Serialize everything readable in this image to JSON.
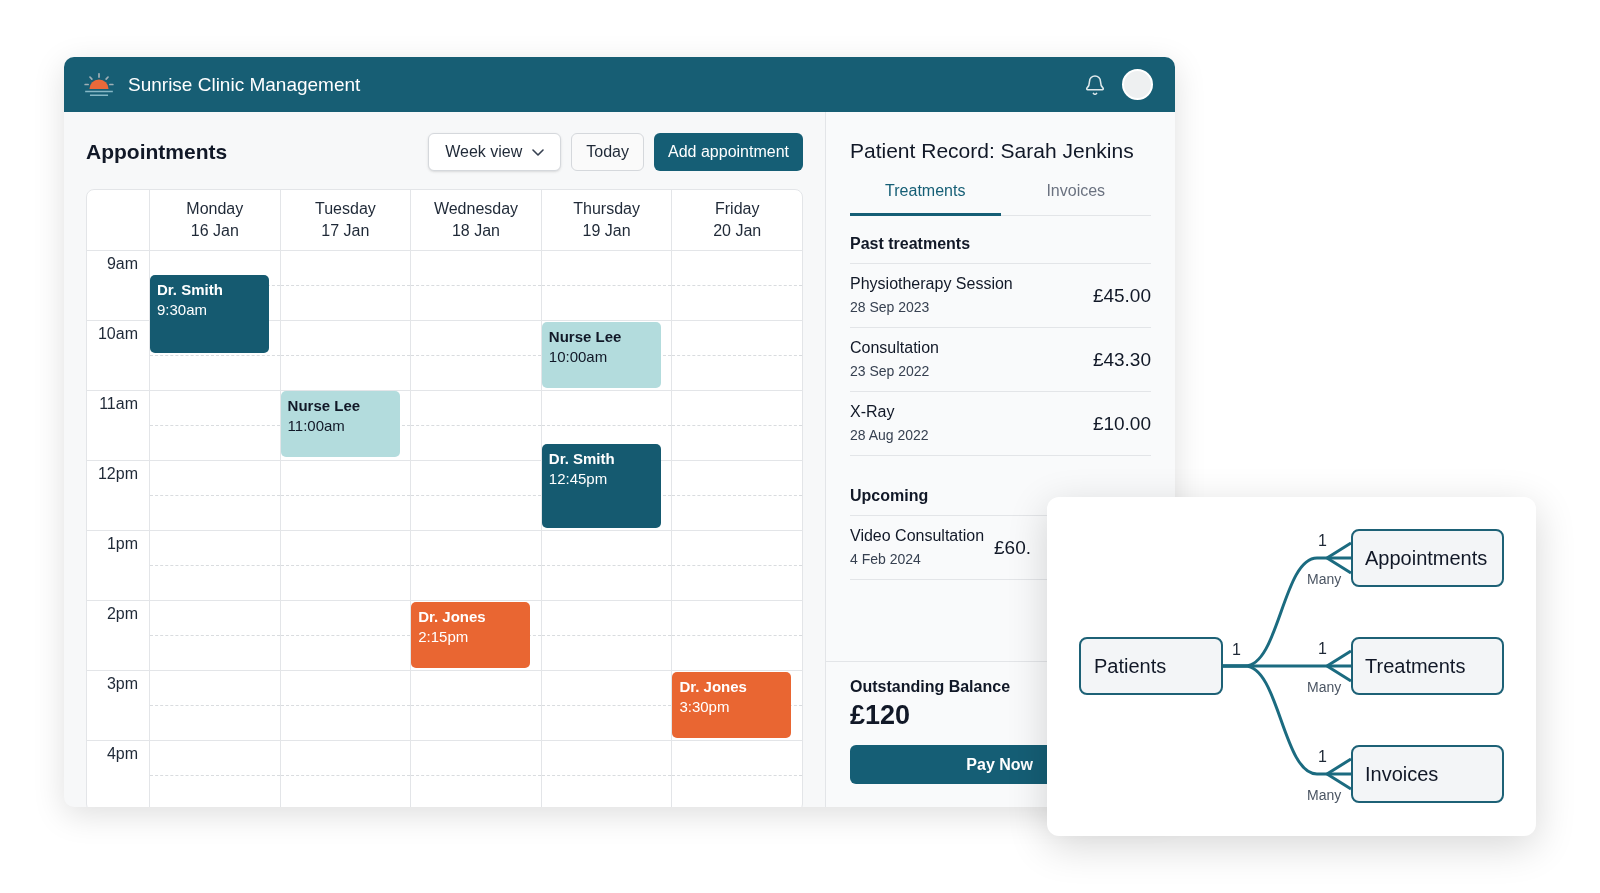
{
  "app": {
    "title": "Sunrise Clinic Management"
  },
  "appointments": {
    "title": "Appointments",
    "view_select": {
      "value": "Week view"
    },
    "buttons": [
      {
        "label": "Today",
        "kind": "secondary"
      },
      {
        "label": "Add appointment",
        "kind": "primary"
      }
    ],
    "calendar": {
      "days": [
        {
          "name": "Monday",
          "date": "16 Jan",
          "events": [
            {
              "title": "Dr. Smith",
              "time": "9:30am",
              "color": "#155a70"
            }
          ]
        },
        {
          "name": "Tuesday",
          "date": "17 Jan",
          "events": [
            {
              "title": "Nurse Lee",
              "time": "11:00am",
              "color": "#b3dcdd"
            }
          ]
        },
        {
          "name": "Wednesday",
          "date": "18 Jan",
          "events": [
            {
              "title": "Dr. Jones",
              "time": "2:15pm",
              "color": "#e96632"
            }
          ]
        },
        {
          "name": "Thursday",
          "date": "19 Jan",
          "events": [
            {
              "title": "Nurse Lee",
              "time": "10:00am",
              "color": "#b3dcdd"
            },
            {
              "title": "Dr. Smith",
              "time": "12:45pm",
              "color": "#155a70"
            }
          ]
        },
        {
          "name": "Friday",
          "date": "20 Jan",
          "events": [
            {
              "title": "Dr. Jones",
              "time": "3:30pm",
              "color": "#e96632"
            }
          ]
        }
      ],
      "hours": [
        "9am",
        "10am",
        "11am",
        "12pm",
        "1pm",
        "2pm",
        "3pm",
        "4pm"
      ]
    }
  },
  "patient_record": {
    "title": "Patient Record: Sarah Jenkins",
    "tabs": [
      {
        "label": "Treatments",
        "selected": true
      },
      {
        "label": "Invoices",
        "selected": false
      }
    ],
    "sections": [
      {
        "heading": "Past treatments",
        "kind": "history",
        "items": [
          {
            "name": "Physiotherapy Session",
            "date": "28 Sep 2023",
            "amount": "£45.00"
          },
          {
            "name": "Consultation",
            "date": "23 Sep 2022",
            "amount": "£43.30"
          },
          {
            "name": "X-Ray",
            "date": "28 Aug 2022",
            "amount": "£10.00"
          }
        ]
      },
      {
        "heading": "Upcoming",
        "kind": "upcoming",
        "items": [
          {
            "name": "Video Consultation",
            "date": "4 Feb 2024",
            "amount": "£60."
          }
        ]
      }
    ],
    "balance": {
      "label": "Outstanding Balance",
      "amount": "£120"
    },
    "pay_button": {
      "label": "Pay Now"
    }
  },
  "er_diagram": {
    "root": {
      "label": "Patients",
      "cardinality": "1"
    },
    "relations": [
      {
        "label": "Appointments",
        "one": "1",
        "many": "Many"
      },
      {
        "label": "Treatments",
        "one": "1",
        "many": "Many"
      },
      {
        "label": "Invoices",
        "one": "1",
        "many": "Many"
      }
    ]
  }
}
